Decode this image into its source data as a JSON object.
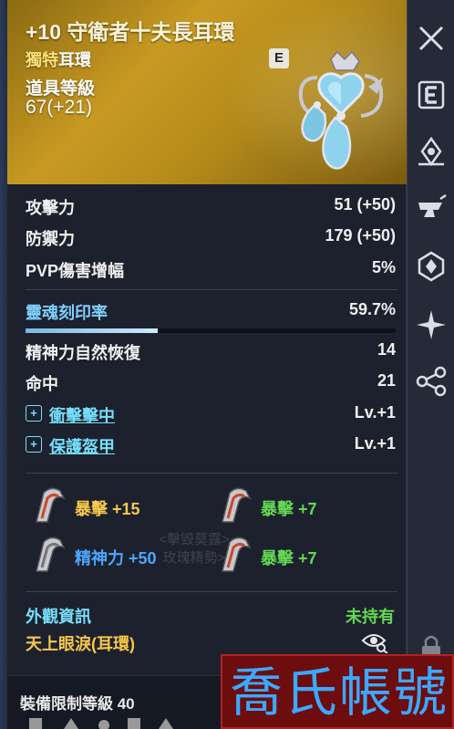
{
  "item": {
    "title": "+10 守衛者十夫長耳環",
    "grade": "獨特",
    "type": "耳環",
    "level_label": "道具等級",
    "level": "67(+21)",
    "badge": "E"
  },
  "stats": [
    {
      "label": "攻擊力",
      "value": "51 (+50)"
    },
    {
      "label": "防禦力",
      "value": "179 (+50)"
    },
    {
      "label": "PVP傷害增幅",
      "value": "5%"
    }
  ],
  "soul": {
    "label": "靈魂刻印率",
    "value": "59.7%",
    "progress": 0.597
  },
  "stats2": [
    {
      "label": "精神力自然恢復",
      "value": "14"
    },
    {
      "label": "命中",
      "value": "21"
    }
  ],
  "skills": [
    {
      "label": "衝擊擊中",
      "value": "Lv.+1"
    },
    {
      "label": "保護盔甲",
      "value": "Lv.+1"
    }
  ],
  "engravings": [
    {
      "name": "暴擊",
      "bonus": "+15",
      "color": "#f7c84a"
    },
    {
      "name": "暴擊",
      "bonus": "+7",
      "color": "#63d853"
    },
    {
      "name": "精神力",
      "bonus": "+50",
      "color": "#4da6ff"
    },
    {
      "name": "暴擊",
      "bonus": "+7",
      "color": "#63d853"
    }
  ],
  "watermark": {
    "line1": "<擊毀莫露>",
    "line2": "玫瑰精勢>"
  },
  "appearance": {
    "label": "外觀資訊",
    "status": "未持有",
    "item": "天上眼淚(耳環)"
  },
  "footer": {
    "requirement": "裝備限制等級 40"
  },
  "sidebar": {
    "icons": [
      "close-icon",
      "enhance-e-icon",
      "soul-icon",
      "anvil-icon",
      "refine-icon",
      "star-icon",
      "share-icon",
      "lock-icon"
    ]
  },
  "stamp": {
    "text": "喬氏帳號"
  },
  "colors": {
    "header": "#c89a22",
    "accent_blue": "#77dffc",
    "green": "#63d853",
    "yellow": "#f7c84a"
  }
}
